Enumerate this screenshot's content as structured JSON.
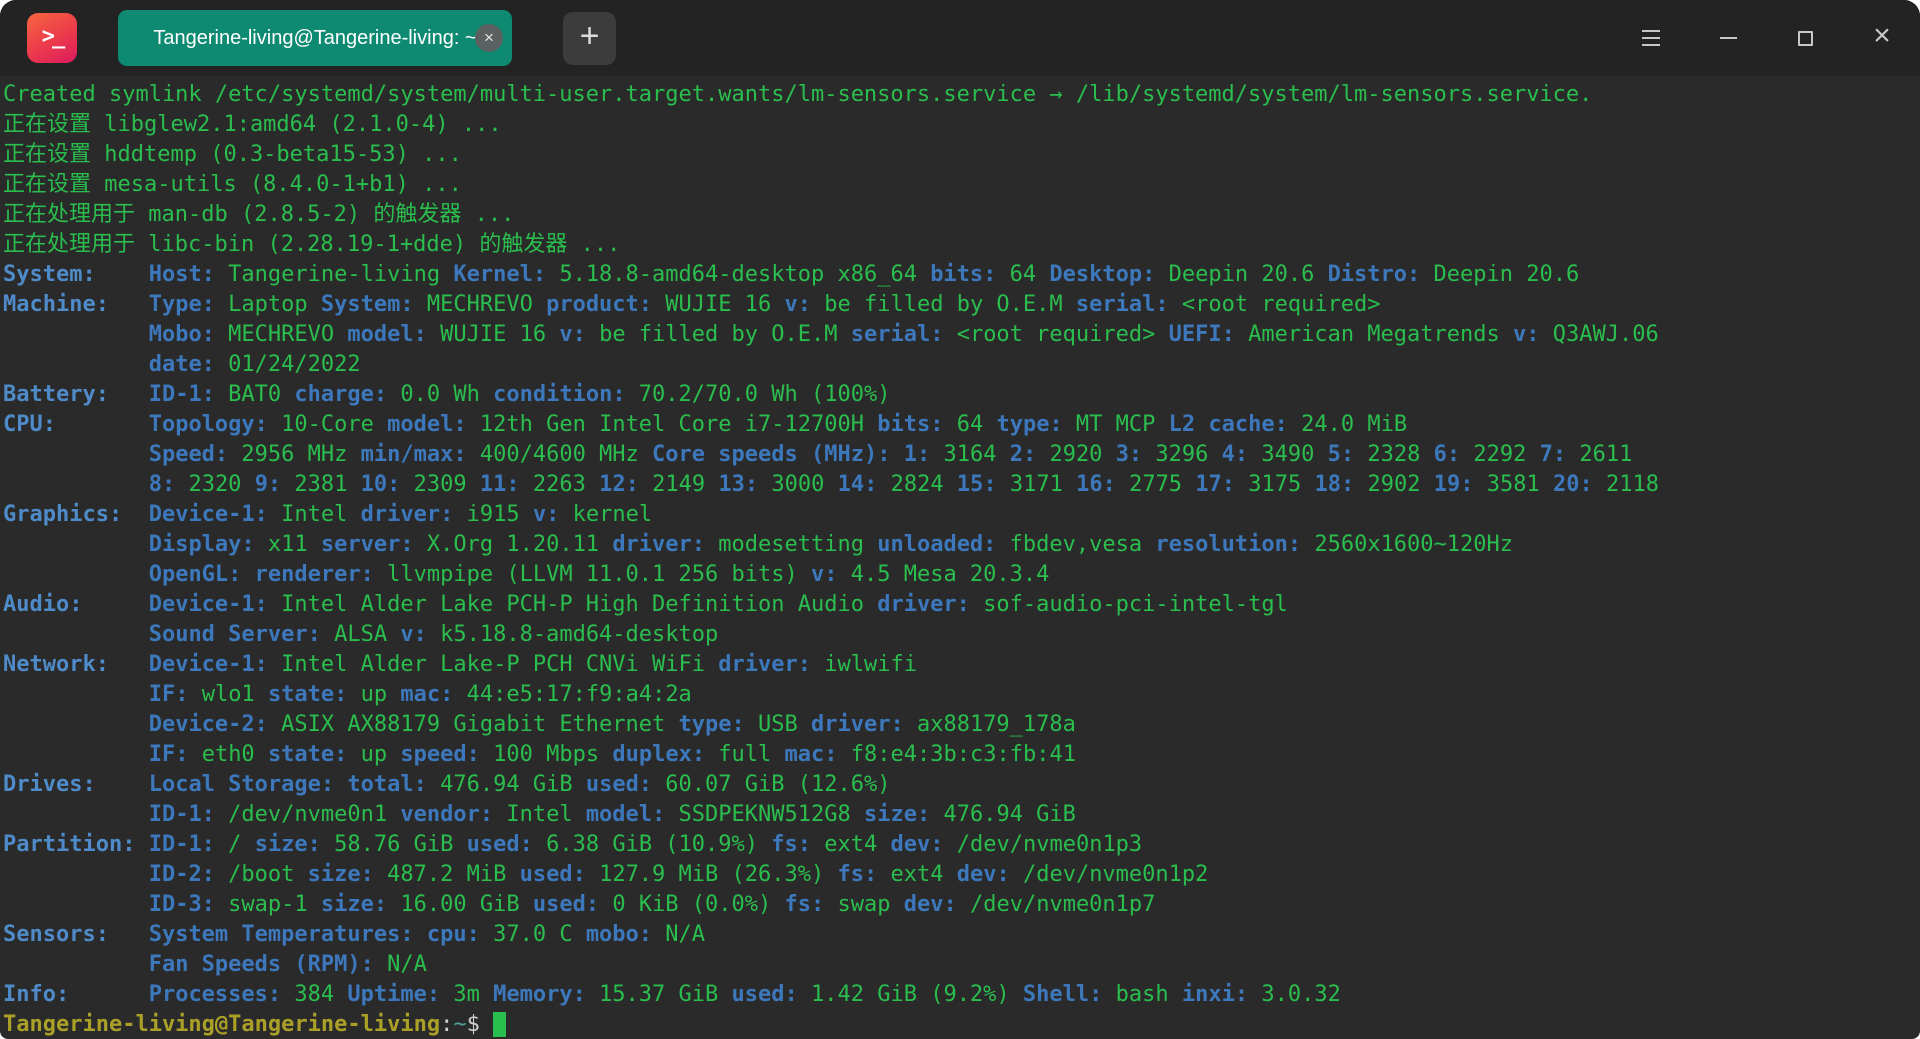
{
  "titlebar": {
    "tab_title": "Tangerine-living@Tangerine-living: ~",
    "app_icon_glyph": ">_",
    "new_tab_glyph": "+",
    "tab_close_glyph": "×",
    "close_glyph": "×",
    "icons": [
      "terminal-app-icon",
      "tab-close-icon",
      "new-tab-icon",
      "menu-icon",
      "minimize-icon",
      "maximize-icon",
      "close-icon"
    ]
  },
  "colors": {
    "terminal_background": "#2a2a2a",
    "titlebar_background": "#232323",
    "tab_background": "#0f8a72",
    "text_green": "#2abe4e",
    "text_key_blue": "#3c78bb",
    "text_category_blue": "#4e8bc8",
    "text_plain": "#d0d0d0",
    "prompt_yellow": "#aaa028",
    "prompt_tilde": "#4ea197",
    "app_icon_gradient_top": "#f4663d",
    "app_icon_gradient_bottom": "#da1b5e"
  },
  "terminal": {
    "lines": [
      [
        [
          "g",
          "Created symlink /etc/systemd/system/multi-user.target.wants/lm-sensors.service → /lib/systemd/system/lm-sensors.service."
        ]
      ],
      [
        [
          "g",
          "正在设置 libglew2.1:amd64 (2.1.0-4) ..."
        ]
      ],
      [
        [
          "g",
          "正在设置 hddtemp (0.3-beta15-53) ..."
        ]
      ],
      [
        [
          "g",
          "正在设置 mesa-utils (8.4.0-1+b1) ..."
        ]
      ],
      [
        [
          "g",
          "正在处理用于 man-db (2.8.5-2) 的触发器 ..."
        ]
      ],
      [
        [
          "g",
          "正在处理用于 libc-bin (2.28.19-1+dde) 的触发器 ..."
        ]
      ],
      [
        [
          "c",
          "System:    "
        ],
        [
          "k",
          "Host:"
        ],
        [
          "g",
          " Tangerine-living "
        ],
        [
          "k",
          "Kernel:"
        ],
        [
          "g",
          " 5.18.8-amd64-desktop x86_64 "
        ],
        [
          "k",
          "bits:"
        ],
        [
          "g",
          " 64 "
        ],
        [
          "k",
          "Desktop:"
        ],
        [
          "g",
          " Deepin 20.6 "
        ],
        [
          "k",
          "Distro:"
        ],
        [
          "g",
          " Deepin 20.6"
        ]
      ],
      [
        [
          "c",
          "Machine:   "
        ],
        [
          "k",
          "Type:"
        ],
        [
          "g",
          " Laptop "
        ],
        [
          "k",
          "System:"
        ],
        [
          "g",
          " MECHREVO "
        ],
        [
          "k",
          "product:"
        ],
        [
          "g",
          " WUJIE 16 "
        ],
        [
          "k",
          "v:"
        ],
        [
          "g",
          " be filled by O.E.M "
        ],
        [
          "k",
          "serial:"
        ],
        [
          "g",
          " <root required>"
        ]
      ],
      [
        [
          "p",
          "           "
        ],
        [
          "k",
          "Mobo:"
        ],
        [
          "g",
          " MECHREVO "
        ],
        [
          "k",
          "model:"
        ],
        [
          "g",
          " WUJIE 16 "
        ],
        [
          "k",
          "v:"
        ],
        [
          "g",
          " be filled by O.E.M "
        ],
        [
          "k",
          "serial:"
        ],
        [
          "g",
          " <root required> "
        ],
        [
          "k",
          "UEFI:"
        ],
        [
          "g",
          " American Megatrends "
        ],
        [
          "k",
          "v:"
        ],
        [
          "g",
          " Q3AWJ.06"
        ]
      ],
      [
        [
          "p",
          "           "
        ],
        [
          "k",
          "date:"
        ],
        [
          "g",
          " 01/24/2022"
        ]
      ],
      [
        [
          "c",
          "Battery:   "
        ],
        [
          "k",
          "ID-1:"
        ],
        [
          "g",
          " BAT0 "
        ],
        [
          "k",
          "charge:"
        ],
        [
          "g",
          " 0.0 Wh "
        ],
        [
          "k",
          "condition:"
        ],
        [
          "g",
          " 70.2/70.0 Wh (100%)"
        ]
      ],
      [
        [
          "c",
          "CPU:       "
        ],
        [
          "k",
          "Topology:"
        ],
        [
          "g",
          " 10-Core "
        ],
        [
          "k",
          "model:"
        ],
        [
          "g",
          " 12th Gen Intel Core i7-12700H "
        ],
        [
          "k",
          "bits:"
        ],
        [
          "g",
          " 64 "
        ],
        [
          "k",
          "type:"
        ],
        [
          "g",
          " MT MCP "
        ],
        [
          "k",
          "L2 cache:"
        ],
        [
          "g",
          " 24.0 MiB"
        ]
      ],
      [
        [
          "p",
          "           "
        ],
        [
          "k",
          "Speed:"
        ],
        [
          "g",
          " 2956 MHz "
        ],
        [
          "k",
          "min/max:"
        ],
        [
          "g",
          " 400/4600 MHz "
        ],
        [
          "k",
          "Core speeds (MHz):"
        ],
        [
          "g",
          " "
        ],
        [
          "k",
          "1:"
        ],
        [
          "g",
          " 3164 "
        ],
        [
          "k",
          "2:"
        ],
        [
          "g",
          " 2920 "
        ],
        [
          "k",
          "3:"
        ],
        [
          "g",
          " 3296 "
        ],
        [
          "k",
          "4:"
        ],
        [
          "g",
          " 3490 "
        ],
        [
          "k",
          "5:"
        ],
        [
          "g",
          " 2328 "
        ],
        [
          "k",
          "6:"
        ],
        [
          "g",
          " 2292 "
        ],
        [
          "k",
          "7:"
        ],
        [
          "g",
          " 2611"
        ]
      ],
      [
        [
          "p",
          "           "
        ],
        [
          "k",
          "8:"
        ],
        [
          "g",
          " 2320 "
        ],
        [
          "k",
          "9:"
        ],
        [
          "g",
          " 2381 "
        ],
        [
          "k",
          "10:"
        ],
        [
          "g",
          " 2309 "
        ],
        [
          "k",
          "11:"
        ],
        [
          "g",
          " 2263 "
        ],
        [
          "k",
          "12:"
        ],
        [
          "g",
          " 2149 "
        ],
        [
          "k",
          "13:"
        ],
        [
          "g",
          " 3000 "
        ],
        [
          "k",
          "14:"
        ],
        [
          "g",
          " 2824 "
        ],
        [
          "k",
          "15:"
        ],
        [
          "g",
          " 3171 "
        ],
        [
          "k",
          "16:"
        ],
        [
          "g",
          " 2775 "
        ],
        [
          "k",
          "17:"
        ],
        [
          "g",
          " 3175 "
        ],
        [
          "k",
          "18:"
        ],
        [
          "g",
          " 2902 "
        ],
        [
          "k",
          "19:"
        ],
        [
          "g",
          " 3581 "
        ],
        [
          "k",
          "20:"
        ],
        [
          "g",
          " 2118"
        ]
      ],
      [
        [
          "c",
          "Graphics:  "
        ],
        [
          "k",
          "Device-1:"
        ],
        [
          "g",
          " Intel "
        ],
        [
          "k",
          "driver:"
        ],
        [
          "g",
          " i915 "
        ],
        [
          "k",
          "v:"
        ],
        [
          "g",
          " kernel"
        ]
      ],
      [
        [
          "p",
          "           "
        ],
        [
          "k",
          "Display:"
        ],
        [
          "g",
          " x11 "
        ],
        [
          "k",
          "server:"
        ],
        [
          "g",
          " X.Org 1.20.11 "
        ],
        [
          "k",
          "driver:"
        ],
        [
          "g",
          " modesetting "
        ],
        [
          "k",
          "unloaded:"
        ],
        [
          "g",
          " fbdev,vesa "
        ],
        [
          "k",
          "resolution:"
        ],
        [
          "g",
          " 2560x1600~120Hz"
        ]
      ],
      [
        [
          "p",
          "           "
        ],
        [
          "k",
          "OpenGL:"
        ],
        [
          "g",
          " "
        ],
        [
          "k",
          "renderer:"
        ],
        [
          "g",
          " llvmpipe (LLVM 11.0.1 256 bits) "
        ],
        [
          "k",
          "v:"
        ],
        [
          "g",
          " 4.5 Mesa 20.3.4"
        ]
      ],
      [
        [
          "c",
          "Audio:     "
        ],
        [
          "k",
          "Device-1:"
        ],
        [
          "g",
          " Intel Alder Lake PCH-P High Definition Audio "
        ],
        [
          "k",
          "driver:"
        ],
        [
          "g",
          " sof-audio-pci-intel-tgl"
        ]
      ],
      [
        [
          "p",
          "           "
        ],
        [
          "k",
          "Sound Server:"
        ],
        [
          "g",
          " ALSA "
        ],
        [
          "k",
          "v:"
        ],
        [
          "g",
          " k5.18.8-amd64-desktop"
        ]
      ],
      [
        [
          "c",
          "Network:   "
        ],
        [
          "k",
          "Device-1:"
        ],
        [
          "g",
          " Intel Alder Lake-P PCH CNVi WiFi "
        ],
        [
          "k",
          "driver:"
        ],
        [
          "g",
          " iwlwifi"
        ]
      ],
      [
        [
          "p",
          "           "
        ],
        [
          "k",
          "IF:"
        ],
        [
          "g",
          " wlo1 "
        ],
        [
          "k",
          "state:"
        ],
        [
          "g",
          " up "
        ],
        [
          "k",
          "mac:"
        ],
        [
          "g",
          " 44:e5:17:f9:a4:2a"
        ]
      ],
      [
        [
          "p",
          "           "
        ],
        [
          "k",
          "Device-2:"
        ],
        [
          "g",
          " ASIX AX88179 Gigabit Ethernet "
        ],
        [
          "k",
          "type:"
        ],
        [
          "g",
          " USB "
        ],
        [
          "k",
          "driver:"
        ],
        [
          "g",
          " ax88179_178a"
        ]
      ],
      [
        [
          "p",
          "           "
        ],
        [
          "k",
          "IF:"
        ],
        [
          "g",
          " eth0 "
        ],
        [
          "k",
          "state:"
        ],
        [
          "g",
          " up "
        ],
        [
          "k",
          "speed:"
        ],
        [
          "g",
          " 100 Mbps "
        ],
        [
          "k",
          "duplex:"
        ],
        [
          "g",
          " full "
        ],
        [
          "k",
          "mac:"
        ],
        [
          "g",
          " f8:e4:3b:c3:fb:41"
        ]
      ],
      [
        [
          "c",
          "Drives:    "
        ],
        [
          "k",
          "Local Storage:"
        ],
        [
          "g",
          " "
        ],
        [
          "k",
          "total:"
        ],
        [
          "g",
          " 476.94 GiB "
        ],
        [
          "k",
          "used:"
        ],
        [
          "g",
          " 60.07 GiB (12.6%)"
        ]
      ],
      [
        [
          "p",
          "           "
        ],
        [
          "k",
          "ID-1:"
        ],
        [
          "g",
          " /dev/nvme0n1 "
        ],
        [
          "k",
          "vendor:"
        ],
        [
          "g",
          " Intel "
        ],
        [
          "k",
          "model:"
        ],
        [
          "g",
          " SSDPEKNW512G8 "
        ],
        [
          "k",
          "size:"
        ],
        [
          "g",
          " 476.94 GiB"
        ]
      ],
      [
        [
          "c",
          "Partition: "
        ],
        [
          "k",
          "ID-1:"
        ],
        [
          "g",
          " / "
        ],
        [
          "k",
          "size:"
        ],
        [
          "g",
          " 58.76 GiB "
        ],
        [
          "k",
          "used:"
        ],
        [
          "g",
          " 6.38 GiB (10.9%) "
        ],
        [
          "k",
          "fs:"
        ],
        [
          "g",
          " ext4 "
        ],
        [
          "k",
          "dev:"
        ],
        [
          "g",
          " /dev/nvme0n1p3"
        ]
      ],
      [
        [
          "p",
          "           "
        ],
        [
          "k",
          "ID-2:"
        ],
        [
          "g",
          " /boot "
        ],
        [
          "k",
          "size:"
        ],
        [
          "g",
          " 487.2 MiB "
        ],
        [
          "k",
          "used:"
        ],
        [
          "g",
          " 127.9 MiB (26.3%) "
        ],
        [
          "k",
          "fs:"
        ],
        [
          "g",
          " ext4 "
        ],
        [
          "k",
          "dev:"
        ],
        [
          "g",
          " /dev/nvme0n1p2"
        ]
      ],
      [
        [
          "p",
          "           "
        ],
        [
          "k",
          "ID-3:"
        ],
        [
          "g",
          " swap-1 "
        ],
        [
          "k",
          "size:"
        ],
        [
          "g",
          " 16.00 GiB "
        ],
        [
          "k",
          "used:"
        ],
        [
          "g",
          " 0 KiB (0.0%) "
        ],
        [
          "k",
          "fs:"
        ],
        [
          "g",
          " swap "
        ],
        [
          "k",
          "dev:"
        ],
        [
          "g",
          " /dev/nvme0n1p7"
        ]
      ],
      [
        [
          "c",
          "Sensors:   "
        ],
        [
          "k",
          "System Temperatures:"
        ],
        [
          "g",
          " "
        ],
        [
          "k",
          "cpu:"
        ],
        [
          "g",
          " 37.0 C "
        ],
        [
          "k",
          "mobo:"
        ],
        [
          "g",
          " N/A"
        ]
      ],
      [
        [
          "p",
          "           "
        ],
        [
          "k",
          "Fan Speeds (RPM):"
        ],
        [
          "g",
          " N/A"
        ]
      ],
      [
        [
          "c",
          "Info:      "
        ],
        [
          "k",
          "Processes:"
        ],
        [
          "g",
          " 384 "
        ],
        [
          "k",
          "Uptime:"
        ],
        [
          "g",
          " 3m "
        ],
        [
          "k",
          "Memory:"
        ],
        [
          "g",
          " 15.37 GiB "
        ],
        [
          "k",
          "used:"
        ],
        [
          "g",
          " 1.42 GiB (9.2%) "
        ],
        [
          "k",
          "Shell:"
        ],
        [
          "g",
          " bash "
        ],
        [
          "k",
          "inxi:"
        ],
        [
          "g",
          " 3.0.32"
        ]
      ],
      [
        [
          "y",
          "Tangerine-living@Tangerine-living"
        ],
        [
          "p",
          ":"
        ],
        [
          "t",
          "~"
        ],
        [
          "p",
          "$ "
        ],
        [
          "cur",
          " "
        ]
      ]
    ]
  }
}
